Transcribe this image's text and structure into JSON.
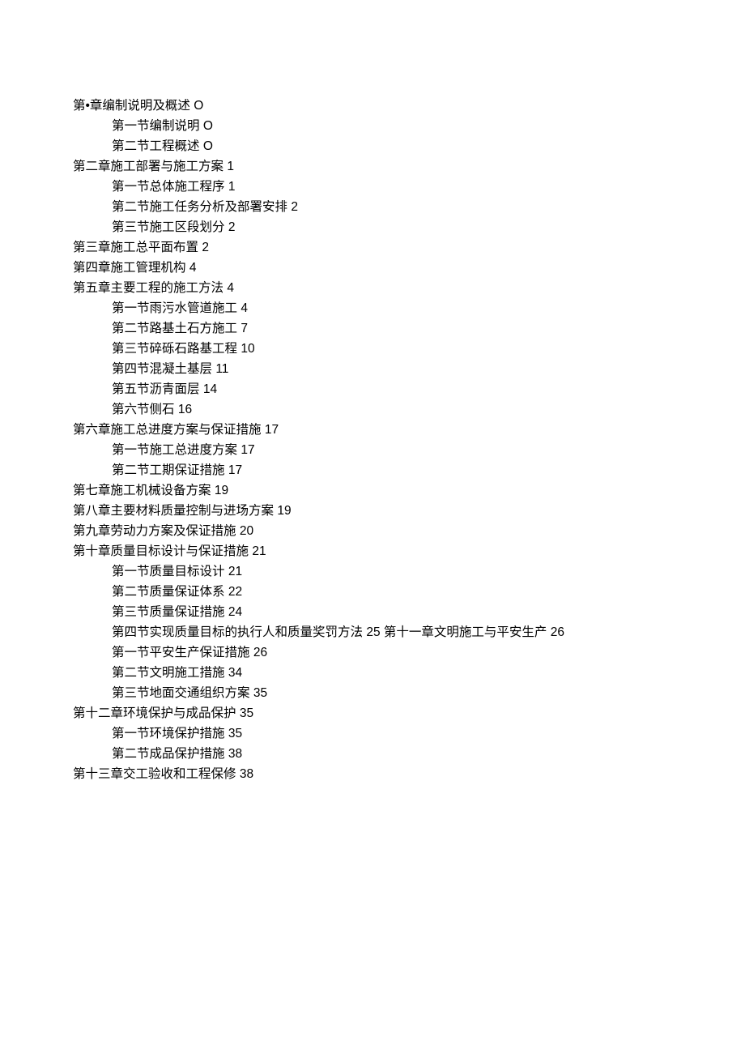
{
  "toc": [
    {
      "level": 0,
      "text": "第•章编制说明及概述"
    },
    {
      "level": 1,
      "text": "第一节编制说明"
    },
    {
      "level": 1,
      "text": "第二节工程概述"
    },
    {
      "level": 0,
      "text": "第二章施工部署与施工方案"
    },
    {
      "level": 1,
      "text": "第一节总体施工程序"
    },
    {
      "level": 1,
      "text": "第二节施工任务分析及部署安排"
    },
    {
      "level": 1,
      "text": "第三节施工区段划分"
    },
    {
      "level": 0,
      "text": "第三章施工总平面布置"
    },
    {
      "level": 0,
      "text": "第四章施工管理机构"
    },
    {
      "level": 0,
      "text": "第五章主要工程的施工方法"
    },
    {
      "level": 1,
      "text": "第一节雨污水管道施工"
    },
    {
      "level": 1,
      "text": "第二节路基土石方施工"
    },
    {
      "level": 1,
      "text": "第三节碎砾石路基工程"
    },
    {
      "level": 1,
      "text": "第四节混凝土基层"
    },
    {
      "level": 1,
      "text": "第五节沥青面层"
    },
    {
      "level": 1,
      "text": "第六节侧石"
    },
    {
      "level": 0,
      "text": "第六章施工总进度方案与保证措施"
    },
    {
      "level": 1,
      "text": "第一节施工总进度方案"
    },
    {
      "level": 1,
      "text": "第二节工期保证措施"
    },
    {
      "level": 0,
      "text": "第七章施工机械设备方案"
    },
    {
      "level": 0,
      "text": "第八章主要材料质量控制与进场方案"
    },
    {
      "level": 0,
      "text": "第九章劳动力方案及保证措施"
    },
    {
      "level": 0,
      "text": "第十章质量目标设计与保证措施"
    },
    {
      "level": 1,
      "text": "第一节质量目标设计"
    },
    {
      "level": 1,
      "text": "第二节质量保证体系"
    },
    {
      "level": 1,
      "text": "第三节质量保证措施"
    },
    {
      "level": 1,
      "text": "第四节实现质量目标的执行人和质量奖罚方法"
    },
    {
      "level": 1,
      "text": "第一节平安生产保证措施"
    },
    {
      "level": 1,
      "text": "第二节文明施工措施"
    },
    {
      "level": 1,
      "text": "第三节地面交通组织方案"
    },
    {
      "level": 0,
      "text": "第十二章环境保护与成品保护"
    },
    {
      "level": 1,
      "text": "第一节环境保护措施"
    },
    {
      "level": 1,
      "text": "第二节成品保护措施"
    },
    {
      "level": 0,
      "text": "第十三章交工验收和工程保修"
    }
  ],
  "pages": [
    "O",
    "O",
    "O",
    "1",
    "1",
    "2",
    "2",
    "2",
    "4",
    "4",
    "4",
    "7",
    "10",
    "11",
    "14",
    "16",
    "17",
    "17",
    "17",
    "19",
    "19",
    "20",
    "21",
    "21",
    "22",
    "24",
    "25",
    "26",
    "34",
    "35",
    "35",
    "35",
    "38",
    "38"
  ],
  "inline_chapter_11": {
    "text": "第十一章文明施工与平安生产",
    "page": "26"
  }
}
